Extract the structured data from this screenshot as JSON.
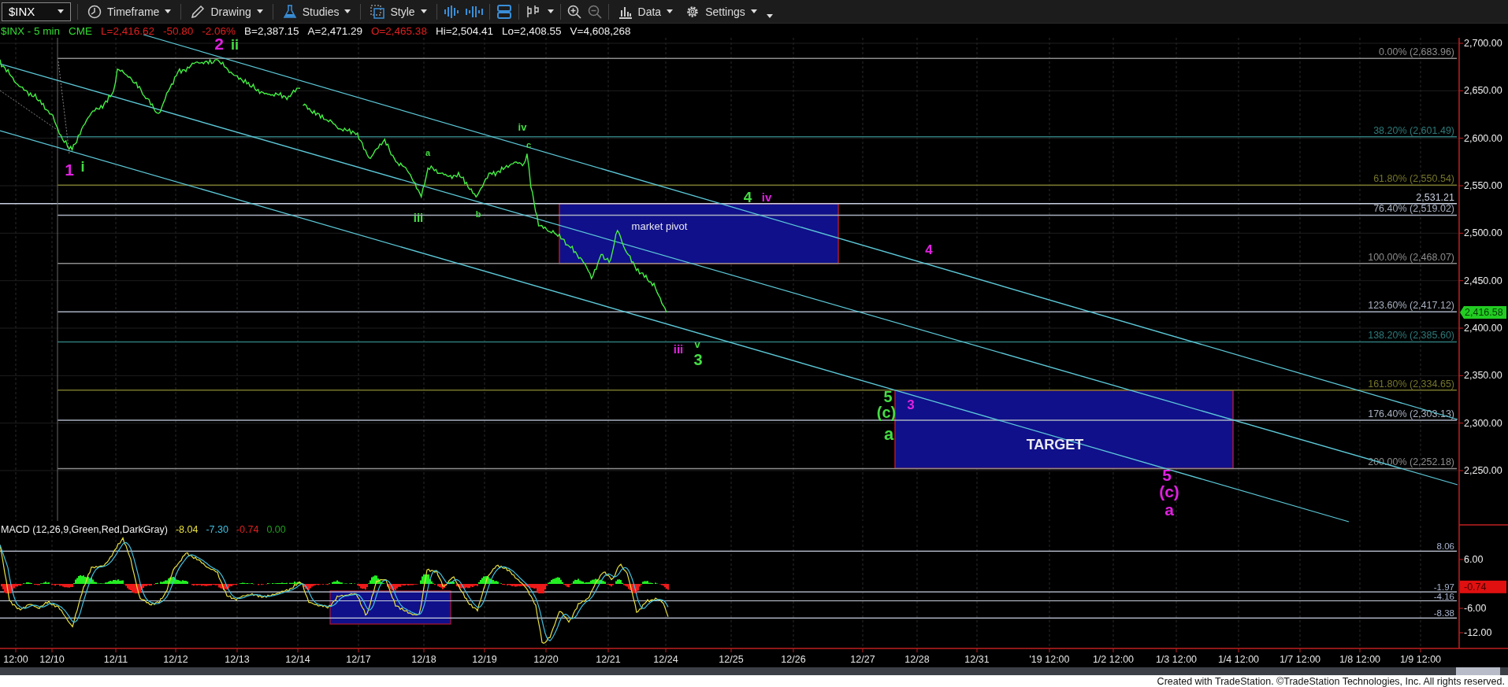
{
  "toolbar": {
    "symbol": "$INX",
    "menus": [
      {
        "kind": "clock",
        "label": "Timeframe"
      },
      {
        "kind": "pencil",
        "label": "Drawing"
      },
      {
        "kind": "flask",
        "label": "Studies"
      },
      {
        "kind": "square",
        "label": "Style"
      }
    ],
    "menus_right": [
      {
        "kind": "bars",
        "label": "Data"
      },
      {
        "kind": "gear",
        "label": "Settings"
      }
    ]
  },
  "quote_line": [
    {
      "text": "$INX - 5 min",
      "color": "#33dd33"
    },
    {
      "text": "CME",
      "color": "#33dd33"
    },
    {
      "text": "L=2,416.62",
      "color": "#e02020"
    },
    {
      "text": "-50.80",
      "color": "#e02020"
    },
    {
      "text": "-2.06%",
      "color": "#e02020"
    },
    {
      "text": "B=2,387.15",
      "color": "#f0f0f0"
    },
    {
      "text": "A=2,471.29",
      "color": "#f0f0f0"
    },
    {
      "text": "O=2,465.38",
      "color": "#e02020"
    },
    {
      "text": "Hi=2,504.41",
      "color": "#f0f0f0"
    },
    {
      "text": "Lo=2,408.55",
      "color": "#f0f0f0"
    },
    {
      "text": "V=4,608,268",
      "color": "#f0f0f0"
    }
  ],
  "fib_levels": [
    {
      "label": "0.00% (2,683.96)",
      "color": "#8c8c8c"
    },
    {
      "label": "38.20% (2,601.49)",
      "color": "#2f7a7a"
    },
    {
      "label": "61.80% (2,550.54)",
      "color": "#76762c"
    },
    {
      "label": "2,531.21",
      "color": "#c8d0e0"
    },
    {
      "label": "76.40% (2,519.02)",
      "color": "#a8b0c0"
    },
    {
      "label": "100.00% (2,468.07)",
      "color": "#8c8c8c"
    },
    {
      "label": "123.60% (2,417.12)",
      "color": "#a8b0c0"
    },
    {
      "label": "138.20% (2,385.60)",
      "color": "#2f7a7a"
    },
    {
      "label": "161.80% (2,334.65)",
      "color": "#76762c"
    },
    {
      "label": "176.40% (2,303.13)",
      "color": "#a8b0c0"
    },
    {
      "label": "200.00% (2,252.18)",
      "color": "#8c8c8c"
    }
  ],
  "zones": [
    {
      "label": "market pivot"
    },
    {
      "label": "TARGET"
    }
  ],
  "wave_labels": [
    {
      "text": "1",
      "color": "#e020e0"
    },
    {
      "text": "i",
      "color": "#44dd44"
    },
    {
      "text": "2",
      "color": "#e020e0"
    },
    {
      "text": "ii",
      "color": "#44dd44"
    },
    {
      "text": "iii",
      "color": "#44dd44"
    },
    {
      "text": "a",
      "color": "#44dd44"
    },
    {
      "text": "b",
      "color": "#44dd44"
    },
    {
      "text": "iv",
      "color": "#44dd44"
    },
    {
      "text": "c",
      "color": "#44dd44"
    },
    {
      "text": "4",
      "color": "#44dd44"
    },
    {
      "text": "iv",
      "color": "#e020e0"
    },
    {
      "text": "4",
      "color": "#e020e0"
    },
    {
      "text": "iii",
      "color": "#e020e0"
    },
    {
      "text": "v",
      "color": "#44dd44"
    },
    {
      "text": "3",
      "color": "#44dd44"
    },
    {
      "text": "5",
      "color": "#44dd44"
    },
    {
      "text": "(c)",
      "color": "#44dd44"
    },
    {
      "text": "a",
      "color": "#44dd44"
    },
    {
      "text": "3",
      "color": "#e020e0"
    },
    {
      "text": "5",
      "color": "#e020e0"
    },
    {
      "text": "(c)",
      "color": "#e020e0"
    },
    {
      "text": "a",
      "color": "#e020e0"
    }
  ],
  "price_axis": {
    "ticks": [
      "2,700.00",
      "2,650.00",
      "2,600.00",
      "2,550.00",
      "2,500.00",
      "2,450.00",
      "2,400.00",
      "2,350.00",
      "2,300.00",
      "2,250.00"
    ],
    "last_price": "2,416.58"
  },
  "macd": {
    "title": "MACD (12,26,9,Green,Red,DarkGray)",
    "values": [
      {
        "text": "-8.04",
        "color": "#e8e040"
      },
      {
        "text": "-7.30",
        "color": "#40c0e0"
      },
      {
        "text": "-0.74",
        "color": "#e02020"
      },
      {
        "text": "0.00",
        "color": "#20a020"
      }
    ],
    "levels": [
      "8.06",
      "-1.97",
      "-4.16",
      "-8.38"
    ],
    "axis_ticks": [
      "6.00",
      "-6.00",
      "-12.00"
    ],
    "last_value": "-0.74"
  },
  "time_axis": [
    "12:00",
    "12/10",
    "12/11",
    "12/12",
    "12/13",
    "12/14",
    "12/17",
    "12/18",
    "12/19",
    "12/20",
    "12/21",
    "12/24",
    "12/25",
    "12/26",
    "12/27",
    "12/28",
    "12/31",
    "'19 12:00",
    "1/2 12:00",
    "1/3 12:00",
    "1/4 12:00",
    "1/7 12:00",
    "1/8 12:00",
    "1/9 12:00"
  ],
  "footer": "Created with TradeStation. ©TradeStation Technologies, Inc. All rights reserved."
}
